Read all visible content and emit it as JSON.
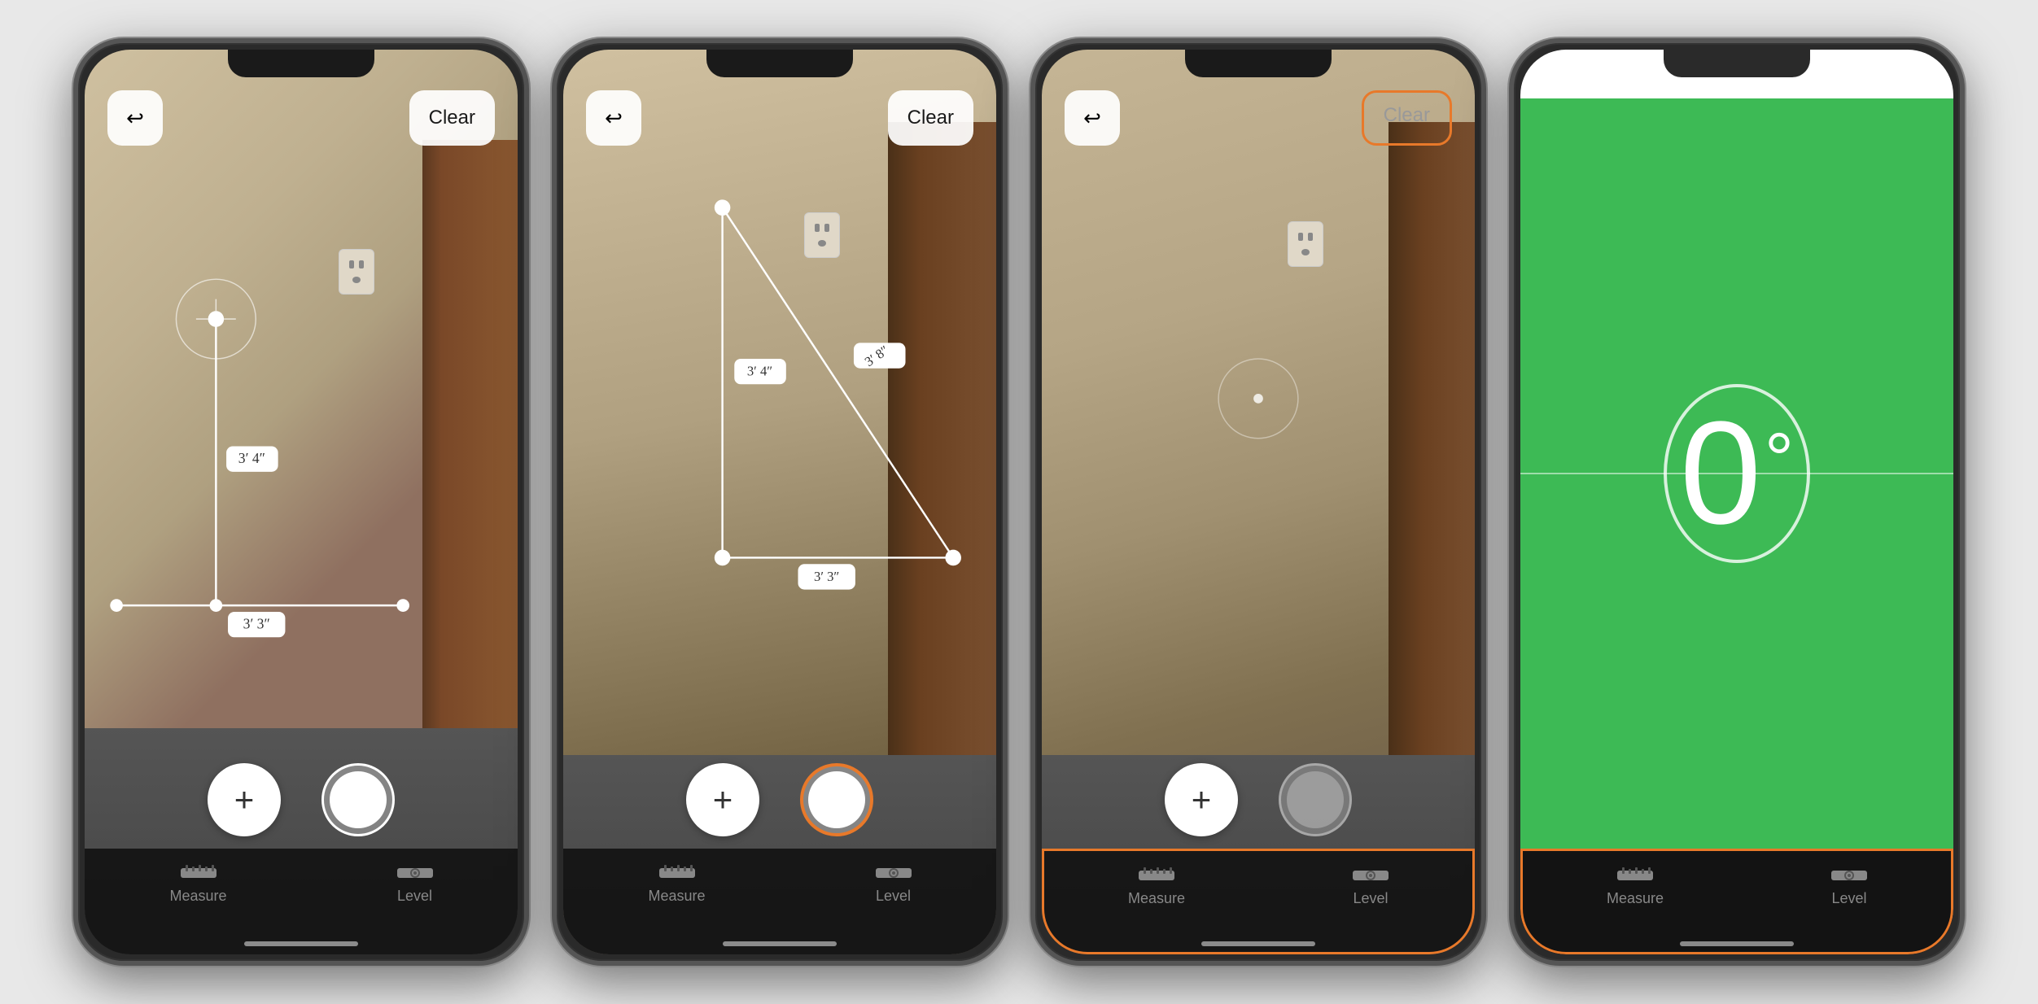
{
  "phones": [
    {
      "id": "phone1",
      "screen": "measure-single",
      "back_button": "←",
      "clear_button": "Clear",
      "clear_highlighted": false,
      "measurements": [
        "3′ 4″",
        "3′ 3″"
      ],
      "tab_bar_highlighted": false,
      "shutter_highlighted": false,
      "tabs": [
        {
          "label": "Measure",
          "icon": "ruler"
        },
        {
          "label": "Level",
          "icon": "level"
        }
      ]
    },
    {
      "id": "phone2",
      "screen": "measure-multi",
      "back_button": "←",
      "clear_button": "Clear",
      "clear_highlighted": false,
      "measurements": [
        "3′ 4″",
        "3′ 8″",
        "3′ 3″"
      ],
      "tab_bar_highlighted": false,
      "shutter_highlighted": true,
      "tabs": [
        {
          "label": "Measure",
          "icon": "ruler"
        },
        {
          "label": "Level",
          "icon": "level"
        }
      ]
    },
    {
      "id": "phone3",
      "screen": "measure-empty",
      "back_button": "←",
      "clear_button": "Clear",
      "clear_highlighted": true,
      "measurements": [],
      "tab_bar_highlighted": true,
      "shutter_highlighted": false,
      "tabs": [
        {
          "label": "Measure",
          "icon": "ruler"
        },
        {
          "label": "Level",
          "icon": "level"
        }
      ]
    },
    {
      "id": "phone4",
      "screen": "level",
      "back_button": null,
      "clear_button": null,
      "clear_highlighted": false,
      "degree": "0",
      "degree_symbol": "°",
      "tab_bar_highlighted": true,
      "shutter_highlighted": false,
      "tabs": [
        {
          "label": "Measure",
          "icon": "ruler"
        },
        {
          "label": "Level",
          "icon": "level"
        }
      ]
    }
  ],
  "orange_color": "#e8792a",
  "highlight_color": "#e8792a"
}
